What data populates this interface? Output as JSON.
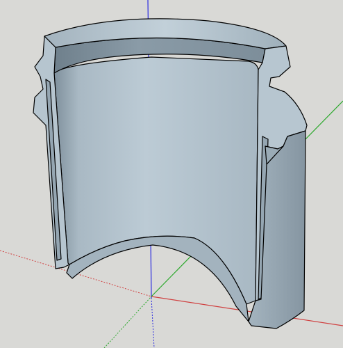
{
  "app": {
    "viewport": {
      "background": "#d9d9d6",
      "axes": {
        "red_color": "#d04040",
        "green_color": "#2aa82a",
        "blue_color": "#2a2ae0"
      },
      "model": {
        "name": "cylindrical-sleeve-section",
        "face_color": "#b9c8d2",
        "shadow_color": "#8fa0ac",
        "edge_color": "#000000"
      }
    }
  }
}
